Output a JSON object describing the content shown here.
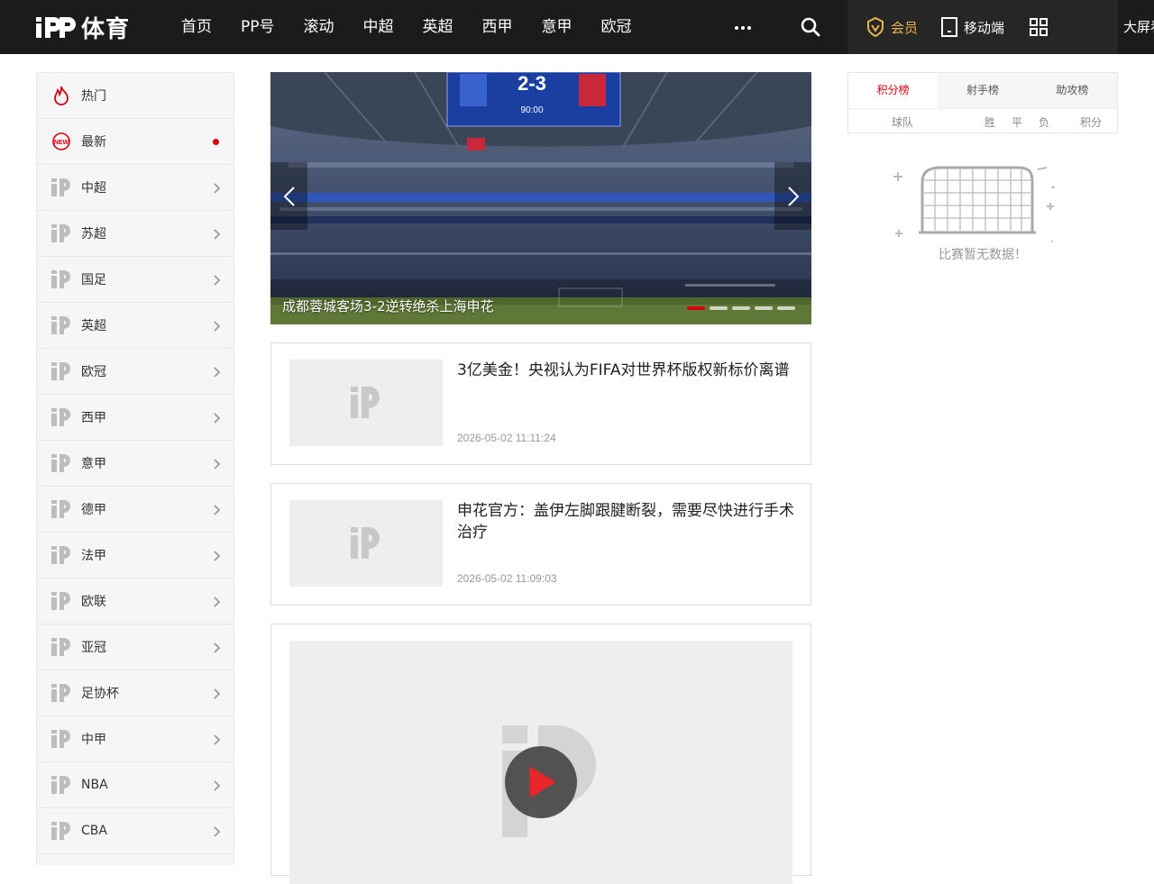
{
  "header": {
    "logo_text": "体育",
    "nav": [
      "首页",
      "PP号",
      "滚动",
      "中超",
      "英超",
      "西甲",
      "意甲",
      "欧冠"
    ],
    "vip_label": "会员",
    "mobile_label": "移动端",
    "bigscreen_label": "大屏看"
  },
  "sidebar": {
    "items": [
      {
        "label": "热门",
        "icon": "flame-icon"
      },
      {
        "label": "最新",
        "icon": "new-badge-icon"
      },
      {
        "label": "中超",
        "icon": "pp-logo-icon"
      },
      {
        "label": "苏超",
        "icon": "pp-logo-icon"
      },
      {
        "label": "国足",
        "icon": "pp-logo-icon"
      },
      {
        "label": "英超",
        "icon": "pp-logo-icon"
      },
      {
        "label": "欧冠",
        "icon": "pp-logo-icon"
      },
      {
        "label": "西甲",
        "icon": "pp-logo-icon"
      },
      {
        "label": "意甲",
        "icon": "pp-logo-icon"
      },
      {
        "label": "德甲",
        "icon": "pp-logo-icon"
      },
      {
        "label": "法甲",
        "icon": "pp-logo-icon"
      },
      {
        "label": "欧联",
        "icon": "pp-logo-icon"
      },
      {
        "label": "亚冠",
        "icon": "pp-logo-icon"
      },
      {
        "label": "足协杯",
        "icon": "pp-logo-icon"
      },
      {
        "label": "中甲",
        "icon": "pp-logo-icon"
      },
      {
        "label": "NBA",
        "icon": "pp-logo-icon"
      },
      {
        "label": "CBA",
        "icon": "pp-logo-icon"
      }
    ]
  },
  "carousel": {
    "caption": "成都蓉城客场3-2逆转绝杀上海申花",
    "score": "2-3",
    "clock": "90:00",
    "active_index": 0,
    "slide_count": 5
  },
  "news": [
    {
      "title": "3亿美金！央视认为FIFA对世界杯版权新标价离谱",
      "time": "2026-05-02 11:11:24"
    },
    {
      "title": "申花官方：盖伊左脚跟腱断裂，需要尽快进行手术治疗",
      "time": "2026-05-02 11:09:03"
    }
  ],
  "rank": {
    "tabs": [
      "积分榜",
      "射手榜",
      "助攻榜"
    ],
    "active_tab": 0,
    "columns": {
      "team": "球队",
      "win": "胜",
      "draw": "平",
      "loss": "负",
      "points": "积分"
    },
    "empty_text": "比赛暂无数据！"
  },
  "colors": {
    "accent": "#d7000f",
    "vip_gold": "#e8b64a",
    "topbar": "#1b1b1b"
  }
}
